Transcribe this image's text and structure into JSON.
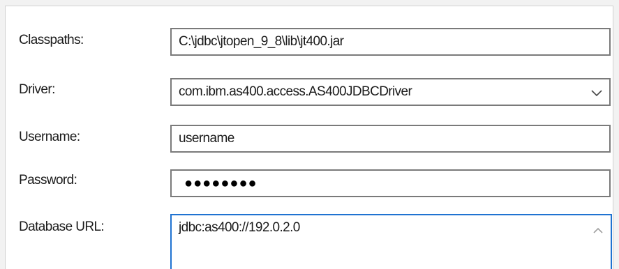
{
  "form": {
    "classpaths": {
      "label": "Classpaths:",
      "value": "C:\\jdbc\\jtopen_9_8\\lib\\jt400.jar"
    },
    "driver": {
      "label": "Driver:",
      "value": "com.ibm.as400.access.AS400JDBCDriver"
    },
    "username": {
      "label": "Username:",
      "value": "username"
    },
    "password": {
      "label": "Password:",
      "masked_value": "●●●●●●●●"
    },
    "database_url": {
      "label": "Database URL:",
      "value": "jdbc:as400://192.0.2.0"
    }
  },
  "icons": {
    "driver_dropdown": "chevron-down-icon",
    "url_scroll": "scroll-up-arrow-icon"
  },
  "colors": {
    "focus_border": "#1f73d1",
    "field_border": "#7a7a7a",
    "panel_bg": "#ffffff",
    "window_bg": "#f2f2f2"
  }
}
